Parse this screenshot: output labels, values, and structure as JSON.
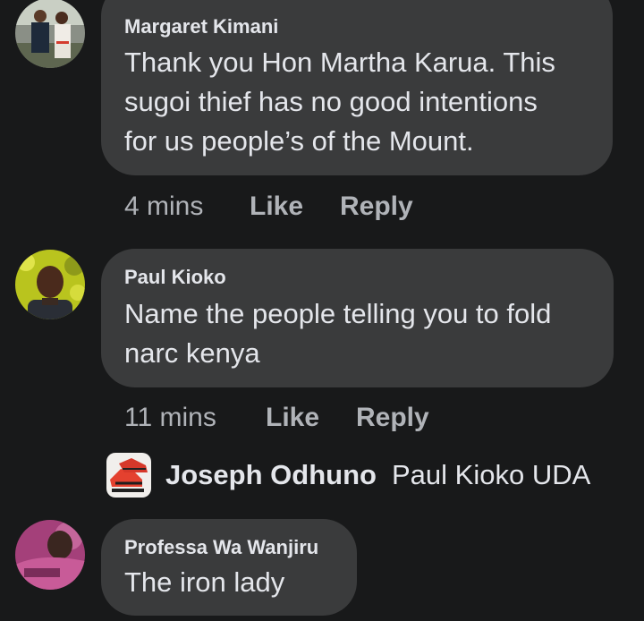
{
  "comments": [
    {
      "author": "Margaret Kimani",
      "lines": [
        "Thank you Hon Martha Karua. This",
        "sugoi thief has no good intentions",
        "for us people’s of the Mount."
      ],
      "time": "4 mins",
      "like": "Like",
      "reply": "Reply",
      "avatar_icon": "couple-photo-avatar"
    },
    {
      "author": "Paul Kioko",
      "lines": [
        "Name the people telling you to fold",
        "narc kenya"
      ],
      "time": "11 mins",
      "like": "Like",
      "reply": "Reply",
      "avatar_icon": "man-portrait-avatar"
    },
    {
      "author": "Professa Wa Wanjiru",
      "lines": [
        "The iron lady"
      ],
      "avatar_icon": "pink-shirt-avatar"
    }
  ],
  "reply_preview": {
    "author": "Joseph Odhuno",
    "text": "Paul Kioko UDA",
    "avatar_icon": "sneakers-photo-avatar"
  },
  "colors": {
    "background": "#18191a",
    "bubble": "#3a3b3c",
    "primary_text": "#e4e6eb",
    "secondary_text": "#b0b3b8"
  }
}
